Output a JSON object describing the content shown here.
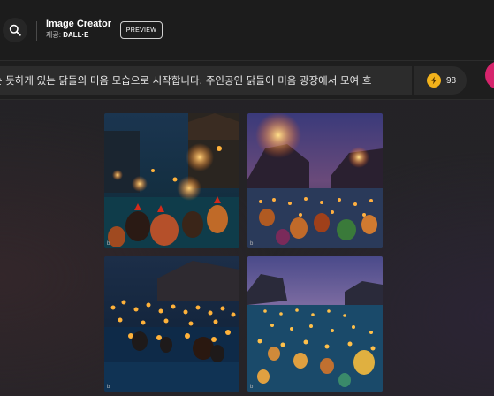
{
  "header": {
    "title": "Image Creator",
    "subtitle_prefix": "제공:",
    "subtitle_brand": "DALL·E",
    "preview_badge": "PREVIEW"
  },
  "prompt": {
    "value": "는 듯하게 있는 닭들의 미음 모습으로 시작합니다. 주인공인 닭들이 미음 광장에서 모여 흐"
  },
  "boosts": {
    "count": "98"
  },
  "images": [
    {
      "alt": "Image 1",
      "mark": "b"
    },
    {
      "alt": "Image 2",
      "mark": "b"
    },
    {
      "alt": "Image 3",
      "mark": "b"
    },
    {
      "alt": "Image 4",
      "mark": "b"
    }
  ],
  "colors": {
    "create_button": "#d6246c",
    "coin": "#f2b21b",
    "topbar": "#1c1c1c"
  }
}
